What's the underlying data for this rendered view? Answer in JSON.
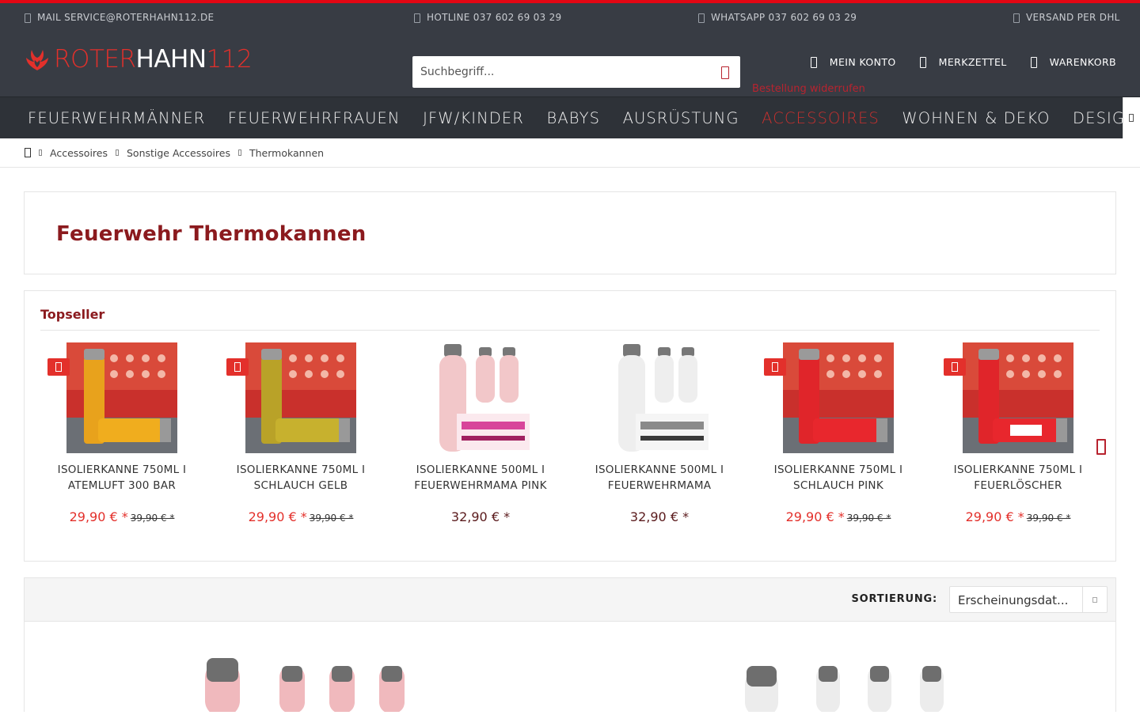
{
  "service_bar": {
    "mail": "MAIL SERVICE@ROTERHAHN112.DE",
    "hotline": "HOTLINE 037 602 69 03 29",
    "whatsapp": "WHATSAPP 037 602 69 03 29",
    "shipping": "VERSAND PER DHL"
  },
  "logo": {
    "part1": "ROTER",
    "part2": "HAHN",
    "part3": "112"
  },
  "search": {
    "placeholder": "Suchbegriff..."
  },
  "account_nav": {
    "account": "MEIN KONTO",
    "wishlist": "MERKZETTEL",
    "cart": "WARENKORB"
  },
  "revoke_link": "Bestellung widerrufen",
  "main_nav": [
    "FEUERWEHRMÄNNER",
    "FEUERWEHRFRAUEN",
    "JFW/KINDER",
    "BABYS",
    "AUSRÜSTUNG",
    "ACCESSOIRES",
    "WOHNEN & DEKO",
    "DESIGNÜBERSICHT"
  ],
  "breadcrumb": [
    "Accessoires",
    "Sonstige Accessoires",
    "Thermokannen"
  ],
  "page_title": "Feuerwehr Thermokannen",
  "topseller": {
    "heading": "Topseller",
    "products": [
      {
        "name_line1": "ISOLIERKANNE 750ML I",
        "name_line2": "ATEMLUFT 300 BAR",
        "price": "29,90 € *",
        "old_price": "39,90 € *",
        "sale": true,
        "image": "yellow-atemluft-bottle"
      },
      {
        "name_line1": "ISOLIERKANNE 750ML I",
        "name_line2": "SCHLAUCH GELB",
        "price": "29,90 € *",
        "old_price": "39,90 € *",
        "sale": true,
        "image": "yellow-schlauch-bottle"
      },
      {
        "name_line1": "ISOLIERKANNE 500ML I",
        "name_line2": "FEUERWEHRMAMA PINK",
        "price": "32,90 € *",
        "old_price": "",
        "sale": false,
        "image": "pink-mama-bottles"
      },
      {
        "name_line1": "ISOLIERKANNE 500ML I",
        "name_line2": "FEUERWEHRMAMA",
        "price": "32,90 € *",
        "old_price": "",
        "sale": false,
        "image": "white-mama-bottles"
      },
      {
        "name_line1": "ISOLIERKANNE 750ML I",
        "name_line2": "SCHLAUCH PINK",
        "price": "29,90 € *",
        "old_price": "39,90 € *",
        "sale": true,
        "image": "red-schlauch-bottle"
      },
      {
        "name_line1": "ISOLIERKANNE 750ML I",
        "name_line2": "FEUERLÖSCHER",
        "price": "29,90 € *",
        "old_price": "39,90 € *",
        "sale": true,
        "image": "red-extinguisher-bottle"
      }
    ]
  },
  "sorting": {
    "label": "SORTIERUNG:",
    "value": "Erscheinungsdat..."
  },
  "colors": {
    "accent": "#e30613",
    "header_bg": "#383c44",
    "nav_bg": "#2e3238",
    "title": "#8b1a1e",
    "price": "#e3302b"
  }
}
